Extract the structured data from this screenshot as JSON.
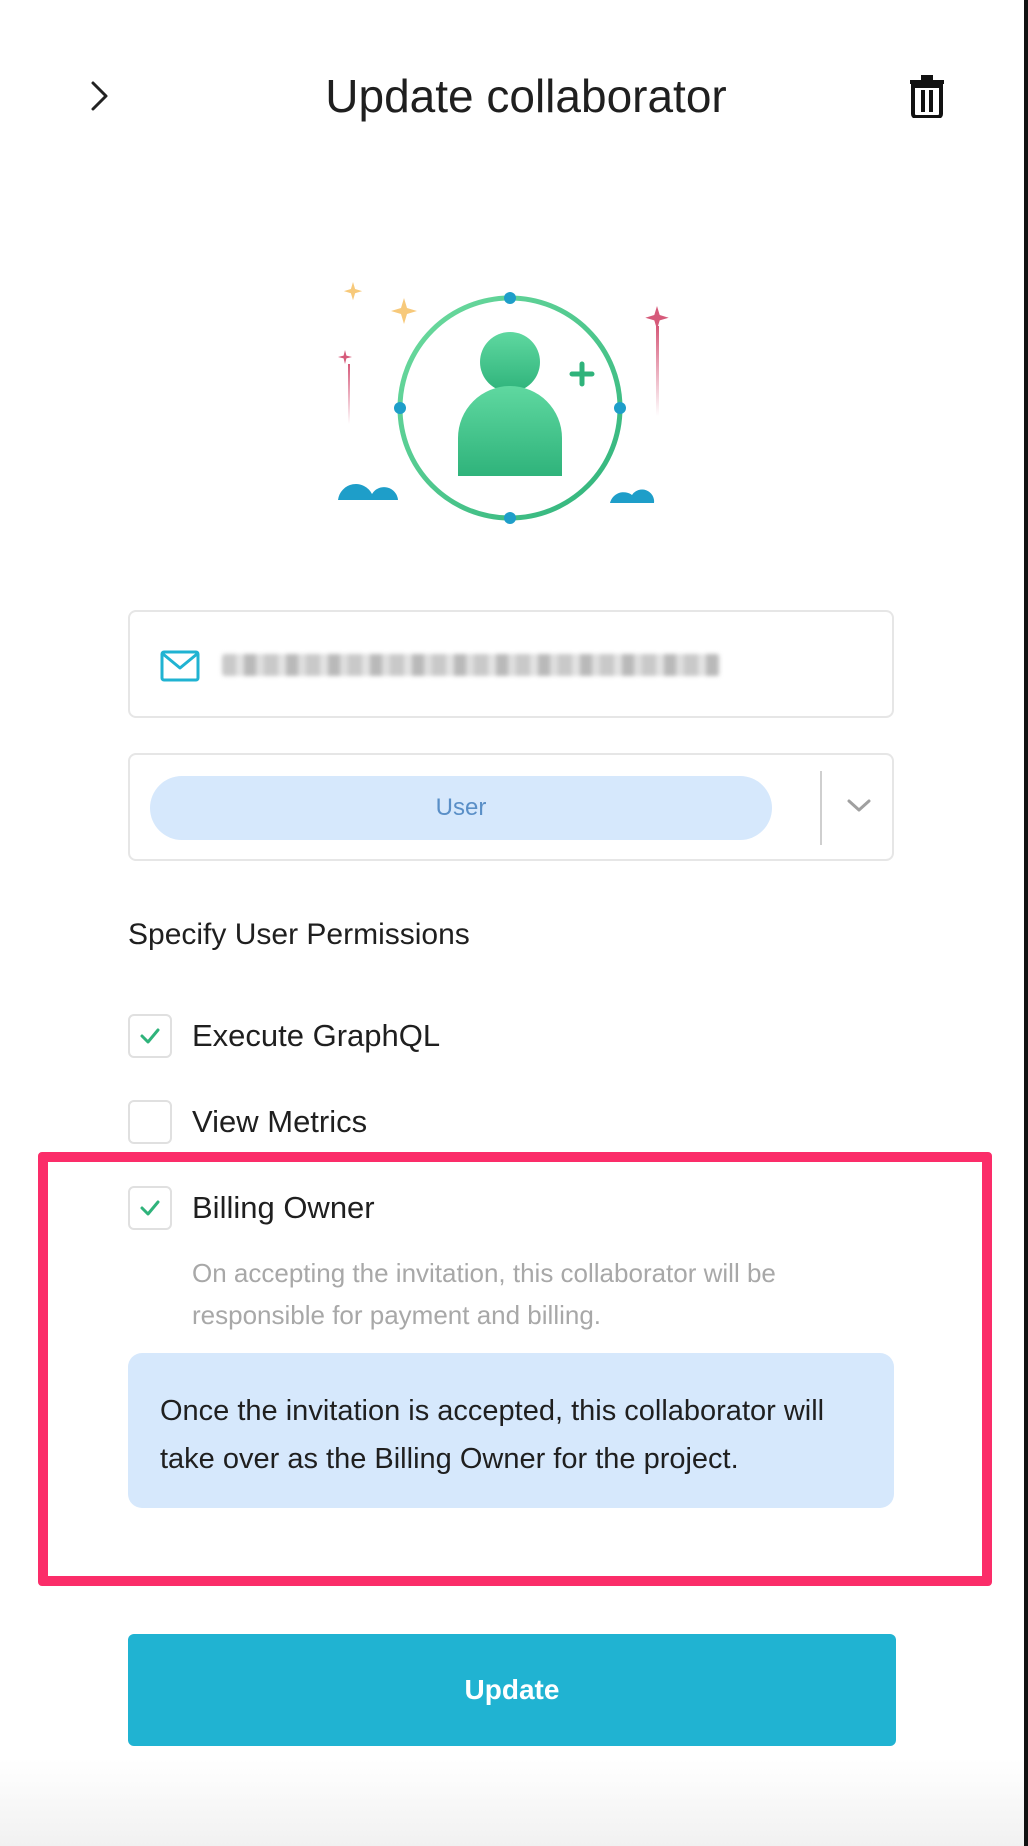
{
  "header": {
    "title": "Update collaborator",
    "back_icon": "chevron-right-icon",
    "delete_icon": "trash-icon"
  },
  "form": {
    "email_icon": "mail-icon",
    "email_value_redacted": true,
    "role": {
      "selected": "User",
      "dropdown_icon": "chevron-down-icon"
    }
  },
  "permissions": {
    "heading": "Specify User Permissions",
    "items": [
      {
        "label": "Execute GraphQL",
        "checked": true
      },
      {
        "label": "View Metrics",
        "checked": false
      },
      {
        "label": "Billing Owner",
        "checked": true
      }
    ],
    "billing_description": "On accepting the invitation, this collaborator will be responsible for payment and billing."
  },
  "info": {
    "text": "Once the invitation is accepted, this collaborator will take over as the Billing Owner for the project."
  },
  "actions": {
    "update_label": "Update"
  },
  "colors": {
    "accent": "#20b3d2",
    "highlight": "#fb2d69",
    "check": "#2fb37b",
    "info_bg": "#d6e8fc",
    "pill_text": "#5a8fc7"
  }
}
